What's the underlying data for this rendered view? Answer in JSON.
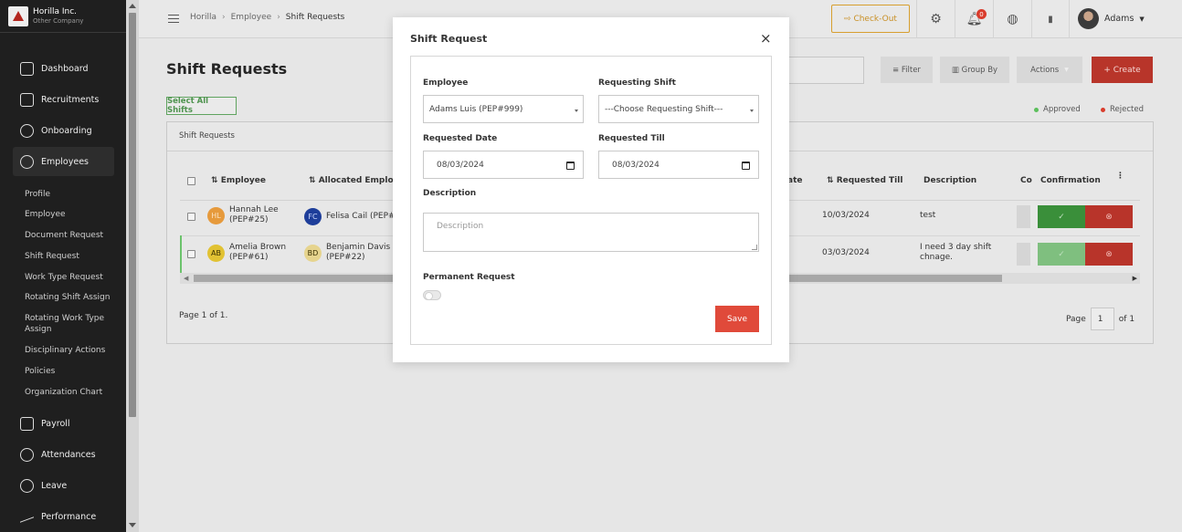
{
  "brand": {
    "name": "Horilla Inc.",
    "sub": "Other Company"
  },
  "sidebar": {
    "items": [
      {
        "label": "Dashboard"
      },
      {
        "label": "Recruitments"
      },
      {
        "label": "Onboarding"
      },
      {
        "label": "Employees"
      },
      {
        "label": "Payroll"
      },
      {
        "label": "Attendances"
      },
      {
        "label": "Leave"
      },
      {
        "label": "Performance"
      }
    ],
    "subitems": [
      "Profile",
      "Employee",
      "Document Request",
      "Shift Request",
      "Work Type Request",
      "Rotating Shift Assign",
      "Rotating Work Type Assign",
      "Disciplinary Actions",
      "Policies",
      "Organization Chart"
    ]
  },
  "topbar": {
    "breadcrumb": [
      "Horilla",
      "Employee",
      "Shift Requests"
    ],
    "separator": "›",
    "checkout": "⇨ Check-Out",
    "notification_count": "0",
    "user": "Adams"
  },
  "main": {
    "title": "Shift Requests",
    "filter": "Filter",
    "group_by": "Group By",
    "actions": "Actions",
    "create": "+ Create",
    "select_all": "Select All Shifts",
    "legend": {
      "approved": "Approved",
      "rejected": "Rejected"
    },
    "panel_title": "Shift Requests",
    "columns": {
      "employee": "Employee",
      "allocated": "Allocated Employe",
      "date": "ate",
      "requested_till": "Requested Till",
      "description": "Description",
      "co": "Co",
      "confirmation": "Confirmation"
    },
    "rows": [
      {
        "initials": "HL",
        "name": "Hannah Lee",
        "id": "(PEP#25)",
        "alloc_initials": "FC",
        "alloc_name": "Felisa Cail (PEP#9",
        "alloc_id": "",
        "till": "10/03/2024",
        "description": "test",
        "description2": ""
      },
      {
        "initials": "AB",
        "name": "Amelia Brown",
        "id": "(PEP#61)",
        "alloc_initials": "BD",
        "alloc_name": "Benjamin Davis",
        "alloc_id": "(PEP#22)",
        "till": "03/03/2024",
        "description": "I need 3 day shift",
        "description2": "chnage."
      }
    ],
    "approve_icon": "✓",
    "reject_icon": "⊗",
    "pager_left": "Page 1 of 1.",
    "pager_label": "Page",
    "pager_value": "1",
    "pager_of": "of 1"
  },
  "modal": {
    "title": "Shift Request",
    "close": "×",
    "employee_label": "Employee",
    "employee_value": "Adams Luis (PEP#999)",
    "shift_label": "Requesting Shift",
    "shift_value": "---Choose Requesting Shift---",
    "requested_date_label": "Requested Date",
    "requested_date_value": "08/03/2024",
    "requested_till_label": "Requested Till",
    "requested_till_value": "08/03/2024",
    "description_label": "Description",
    "description_placeholder": "Description",
    "permanent_label": "Permanent Request",
    "save": "Save"
  },
  "colors": {
    "sidebar": "#1f1f1f",
    "accent_red": "#e04a3a",
    "approve_green": "#3a8f3a",
    "checkout_amber": "#d79f2f"
  }
}
